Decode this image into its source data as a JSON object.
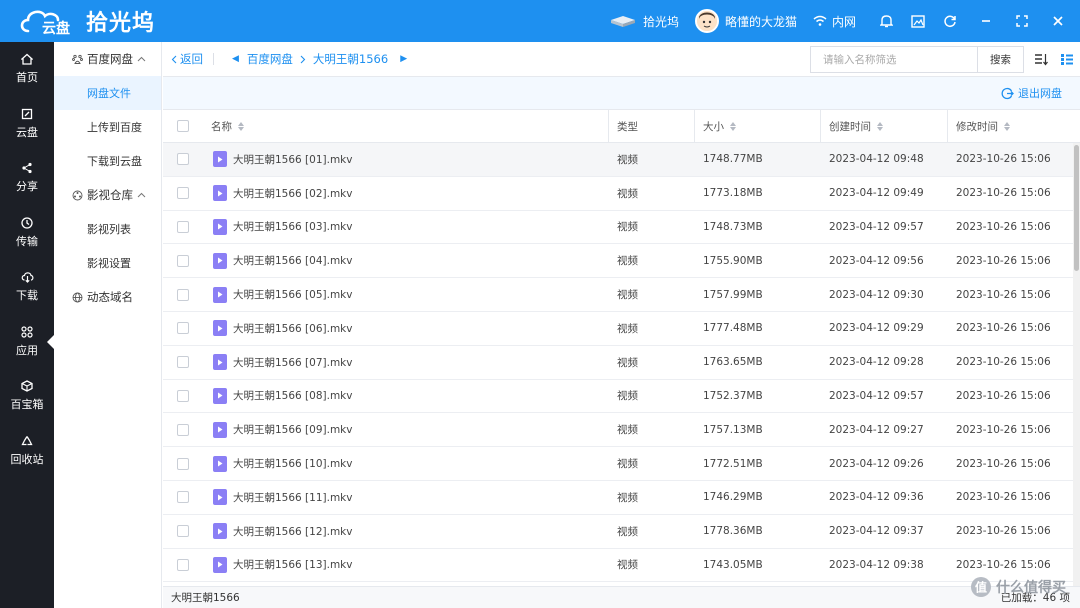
{
  "header": {
    "logo_mark": "云盘",
    "app_name": "拾光坞",
    "device_label": "拾光坞",
    "user_name": "略懂的大龙猫",
    "network_label": "内网"
  },
  "rail": [
    {
      "label": "首页",
      "icon": "home-icon"
    },
    {
      "label": "云盘",
      "icon": "cloud-disk-icon"
    },
    {
      "label": "分享",
      "icon": "share-icon"
    },
    {
      "label": "传输",
      "icon": "transfer-icon"
    },
    {
      "label": "下载",
      "icon": "download-icon"
    },
    {
      "label": "应用",
      "icon": "apps-icon"
    },
    {
      "label": "百宝箱",
      "icon": "toolbox-icon"
    },
    {
      "label": "回收站",
      "icon": "recycle-icon"
    }
  ],
  "sidebar": {
    "group1": "百度网盘",
    "items1": [
      "网盘文件",
      "上传到百度",
      "下载到云盘"
    ],
    "group2": "影视仓库",
    "items2": [
      "影视列表",
      "影视设置"
    ],
    "group3": "动态域名"
  },
  "pathbar": {
    "back": "返回",
    "crumb1": "百度网盘",
    "crumb2": "大明王朝1566",
    "search_placeholder": "请输入名称筛选",
    "search_button": "搜索"
  },
  "actionbar": {
    "exit_label": "退出网盘"
  },
  "table": {
    "headers": {
      "name": "名称",
      "type": "类型",
      "size": "大小",
      "created": "创建时间",
      "modified": "修改时间"
    },
    "rows": [
      {
        "name": "大明王朝1566 [01].mkv",
        "type": "视频",
        "size": "1748.77MB",
        "created": "2023-04-12 09:48",
        "modified": "2023-10-26 15:06"
      },
      {
        "name": "大明王朝1566 [02].mkv",
        "type": "视频",
        "size": "1773.18MB",
        "created": "2023-04-12 09:49",
        "modified": "2023-10-26 15:06"
      },
      {
        "name": "大明王朝1566 [03].mkv",
        "type": "视频",
        "size": "1748.73MB",
        "created": "2023-04-12 09:57",
        "modified": "2023-10-26 15:06"
      },
      {
        "name": "大明王朝1566 [04].mkv",
        "type": "视频",
        "size": "1755.90MB",
        "created": "2023-04-12 09:56",
        "modified": "2023-10-26 15:06"
      },
      {
        "name": "大明王朝1566 [05].mkv",
        "type": "视频",
        "size": "1757.99MB",
        "created": "2023-04-12 09:30",
        "modified": "2023-10-26 15:06"
      },
      {
        "name": "大明王朝1566 [06].mkv",
        "type": "视频",
        "size": "1777.48MB",
        "created": "2023-04-12 09:29",
        "modified": "2023-10-26 15:06"
      },
      {
        "name": "大明王朝1566 [07].mkv",
        "type": "视频",
        "size": "1763.65MB",
        "created": "2023-04-12 09:28",
        "modified": "2023-10-26 15:06"
      },
      {
        "name": "大明王朝1566 [08].mkv",
        "type": "视频",
        "size": "1752.37MB",
        "created": "2023-04-12 09:57",
        "modified": "2023-10-26 15:06"
      },
      {
        "name": "大明王朝1566 [09].mkv",
        "type": "视频",
        "size": "1757.13MB",
        "created": "2023-04-12 09:27",
        "modified": "2023-10-26 15:06"
      },
      {
        "name": "大明王朝1566 [10].mkv",
        "type": "视频",
        "size": "1772.51MB",
        "created": "2023-04-12 09:26",
        "modified": "2023-10-26 15:06"
      },
      {
        "name": "大明王朝1566 [11].mkv",
        "type": "视频",
        "size": "1746.29MB",
        "created": "2023-04-12 09:36",
        "modified": "2023-10-26 15:06"
      },
      {
        "name": "大明王朝1566 [12].mkv",
        "type": "视频",
        "size": "1778.36MB",
        "created": "2023-04-12 09:37",
        "modified": "2023-10-26 15:06"
      },
      {
        "name": "大明王朝1566 [13].mkv",
        "type": "视频",
        "size": "1743.05MB",
        "created": "2023-04-12 09:38",
        "modified": "2023-10-26 15:06"
      }
    ]
  },
  "status": {
    "folder": "大明王朝1566",
    "loaded": "已加载：46 项"
  },
  "watermark": "值 什么值得买",
  "colors": {
    "primary": "#1e90f0",
    "rail_bg": "#1c1f26",
    "file_icon": "#8b7ff5"
  }
}
